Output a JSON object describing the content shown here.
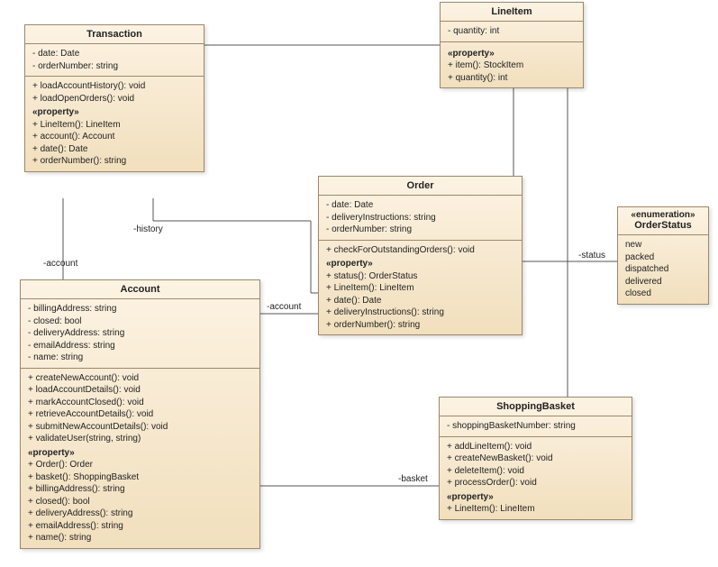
{
  "classes": {
    "transaction": {
      "name": "Transaction",
      "attrs": [
        "-   date: Date",
        "-   orderNumber: string"
      ],
      "ops1": [
        "+   loadAccountHistory(): void",
        "+   loadOpenOrders(): void"
      ],
      "props": [
        "+   LineItem(): LineItem",
        "+   account(): Account",
        "+   date(): Date",
        "+   orderNumber(): string"
      ],
      "propsLabel": "«property»"
    },
    "lineitem": {
      "name": "LineItem",
      "attrs": [
        "-   quantity: int"
      ],
      "props": [
        "+   item(): StockItem",
        "+   quantity(): int"
      ],
      "propsLabel": "«property»"
    },
    "order": {
      "name": "Order",
      "attrs": [
        "-   date: Date",
        "-   deliveryInstructions: string",
        "-   orderNumber: string"
      ],
      "ops1": [
        "+   checkForOutstandingOrders(): void"
      ],
      "props": [
        "+   status(): OrderStatus",
        "+   LineItem(): LineItem",
        "+   date(): Date",
        "+   deliveryInstructions(): string",
        "+   orderNumber(): string"
      ],
      "propsLabel": "«property»"
    },
    "orderstatus": {
      "stereotype": "«enumeration»",
      "name": "OrderStatus",
      "literals": [
        "new",
        "packed",
        "dispatched",
        "delivered",
        "closed"
      ]
    },
    "account": {
      "name": "Account",
      "attrs": [
        "-   billingAddress: string",
        "-   closed: bool",
        "-   deliveryAddress: string",
        "-   emailAddress: string",
        "-   name: string"
      ],
      "ops1": [
        "+   createNewAccount(): void",
        "+   loadAccountDetails(): void",
        "+   markAccountClosed(): void",
        "+   retrieveAccountDetails(): void",
        "+   submitNewAccountDetails(): void",
        "+   validateUser(string, string)"
      ],
      "props": [
        "+   Order(): Order",
        "+   basket(): ShoppingBasket",
        "+   billingAddress(): string",
        "+   closed(): bool",
        "+   deliveryAddress(): string",
        "+   emailAddress(): string",
        "+   name(): string"
      ],
      "propsLabel": "«property»"
    },
    "shoppingbasket": {
      "name": "ShoppingBasket",
      "attrs": [
        "-   shoppingBasketNumber: string"
      ],
      "ops1": [
        "+   addLineItem(): void",
        "+   createNewBasket(): void",
        "+   deleteItem(): void",
        "+   processOrder(): void"
      ],
      "props": [
        "+   LineItem(): LineItem"
      ],
      "propsLabel": "«property»"
    }
  },
  "labels": {
    "history": "-history",
    "account1": "-account",
    "account2": "-account",
    "status": "-status",
    "basket": "-basket"
  }
}
